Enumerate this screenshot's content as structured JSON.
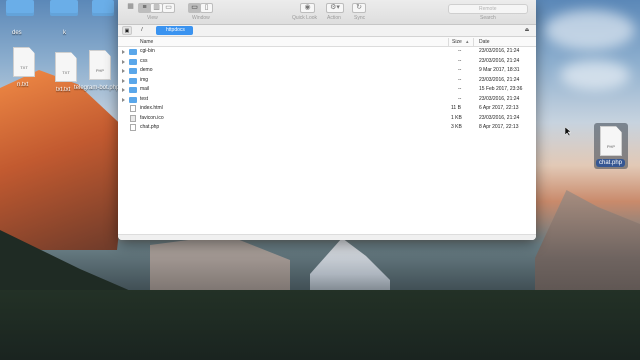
{
  "desktop": {
    "icons": [
      {
        "label": "des"
      },
      {
        "label": "k"
      }
    ],
    "files": [
      {
        "label": "n.txt",
        "ext": "TXT"
      },
      {
        "label": "txt.txt",
        "ext": "TXT"
      },
      {
        "label": "telegram-bot.php",
        "ext": "PHP"
      }
    ],
    "selected_file": {
      "label": "chat.php",
      "ext": "PHP"
    }
  },
  "window": {
    "toolbar": {
      "view_label": "View",
      "window_label": "Window",
      "quicklook_label": "Quick Look",
      "action_label": "Action",
      "sync_label": "Sync",
      "search_label": "Search",
      "search_placeholder": "Remote"
    },
    "path": {
      "root": "/",
      "current": "httpdocs"
    },
    "columns": {
      "name": "Name",
      "size": "Size",
      "date": "Date"
    },
    "files": [
      {
        "name": "cgi-bin",
        "type": "folder",
        "size": "--",
        "date": "23/03/2016, 21:24"
      },
      {
        "name": "css",
        "type": "folder",
        "size": "--",
        "date": "23/03/2016, 21:24"
      },
      {
        "name": "demo",
        "type": "folder",
        "size": "--",
        "date": "9 Mar 2017, 18:31"
      },
      {
        "name": "img",
        "type": "folder",
        "size": "--",
        "date": "23/03/2016, 21:24"
      },
      {
        "name": "mail",
        "type": "folder",
        "size": "--",
        "date": "15 Feb 2017, 23:36"
      },
      {
        "name": "test",
        "type": "folder",
        "size": "--",
        "date": "23/03/2016, 21:24"
      },
      {
        "name": "index.html",
        "type": "file",
        "size": "11 B",
        "date": "6 Apr 2017, 22:13"
      },
      {
        "name": "favicon.ico",
        "type": "file",
        "size": "1 KB",
        "date": "23/03/2016, 21:24"
      },
      {
        "name": "chat.php",
        "type": "file",
        "size": "3 KB",
        "date": "8 Apr 2017, 22:13"
      }
    ]
  }
}
